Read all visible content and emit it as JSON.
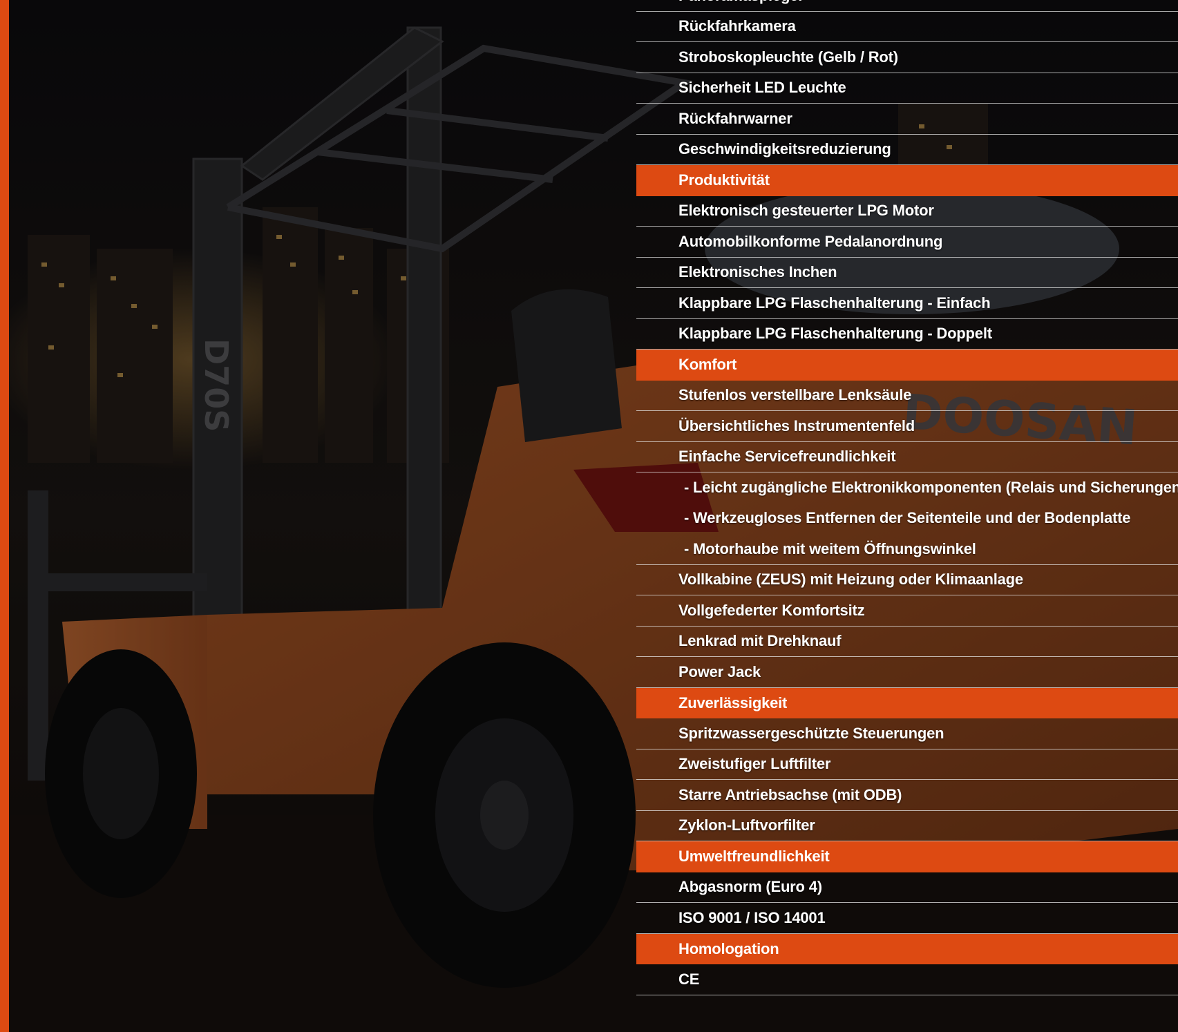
{
  "colors": {
    "accent": "#dd4a12",
    "rule": "#e6e6e6",
    "text": "#ffffff"
  },
  "brand_logo_text": "DOOSAN",
  "mast_lettering": "D70S",
  "features": [
    {
      "type": "item",
      "label": "Panoramaspiegel"
    },
    {
      "type": "item",
      "label": "Rückfahrkamera"
    },
    {
      "type": "item",
      "label": "Stroboskopleuchte (Gelb / Rot)"
    },
    {
      "type": "item",
      "label": "Sicherheit LED Leuchte"
    },
    {
      "type": "item",
      "label": "Rückfahrwarner"
    },
    {
      "type": "item",
      "label": "Geschwindigkeitsreduzierung"
    },
    {
      "type": "header",
      "label": "Produktivität"
    },
    {
      "type": "item",
      "label": "Elektronisch gesteuerter LPG Motor"
    },
    {
      "type": "item",
      "label": "Automobilkonforme Pedalanordnung"
    },
    {
      "type": "item",
      "label": "Elektronisches Inchen"
    },
    {
      "type": "item",
      "label": "Klappbare  LPG Flaschenhalterung - Einfach"
    },
    {
      "type": "item",
      "label": "Klappbare LPG Flaschenhalterung - Doppelt"
    },
    {
      "type": "header",
      "label": "Komfort"
    },
    {
      "type": "item",
      "label": "Stufenlos verstellbare Lenksäule"
    },
    {
      "type": "item",
      "label": "Übersichtliches Instrumentenfeld"
    },
    {
      "type": "item",
      "label": "Einfache Servicefreundlichkeit"
    },
    {
      "type": "sub",
      "label": "- Leicht zugängliche Elektronikkomponenten (Relais und Sicherungen)"
    },
    {
      "type": "sub",
      "label": "- Werkzeugloses Entfernen der Seitenteile und der Bodenplatte"
    },
    {
      "type": "sub-last",
      "label": "- Motorhaube mit weitem Öffnungswinkel"
    },
    {
      "type": "item",
      "label": "Vollkabine (ZEUS) mit Heizung oder Klimaanlage"
    },
    {
      "type": "item",
      "label": "Vollgefederter Komfortsitz"
    },
    {
      "type": "item",
      "label": "Lenkrad mit Drehknauf"
    },
    {
      "type": "item",
      "label": "Power Jack"
    },
    {
      "type": "header",
      "label": "Zuverlässigkeit"
    },
    {
      "type": "item",
      "label": "Spritzwassergeschützte Steuerungen"
    },
    {
      "type": "item",
      "label": "Zweistufiger Luftfilter"
    },
    {
      "type": "item",
      "label": "Starre Antriebsachse (mit  ODB)"
    },
    {
      "type": "item",
      "label": "Zyklon-Luftvorfilter"
    },
    {
      "type": "header",
      "label": "Umweltfreundlichkeit"
    },
    {
      "type": "item",
      "label": "Abgasnorm (Euro 4)"
    },
    {
      "type": "item",
      "label": "ISO 9001 / ISO 14001"
    },
    {
      "type": "header",
      "label": "Homologation"
    },
    {
      "type": "item",
      "label": "CE"
    }
  ]
}
